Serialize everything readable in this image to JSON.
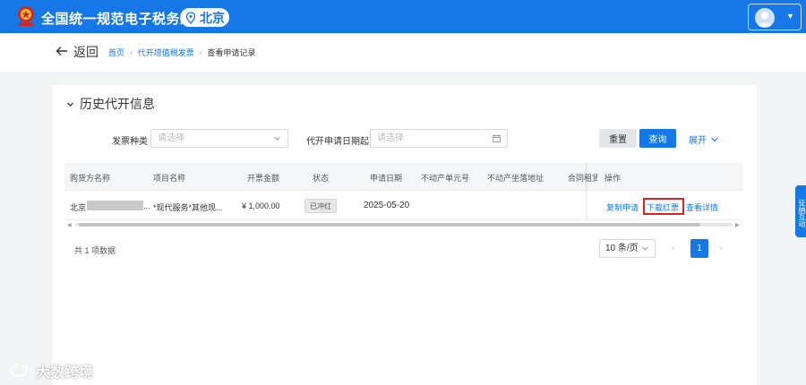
{
  "header": {
    "site_title": "全国统一规范电子税务局",
    "region": "北京"
  },
  "subheader": {
    "back_label": "返回",
    "breadcrumb": [
      "首页",
      "代开增值税发票",
      "查看申请记录"
    ]
  },
  "section": {
    "title": "历史代开信息"
  },
  "filters": {
    "invoice_type_label": "发票种类",
    "invoice_type_placeholder": "请选择",
    "apply_date_label": "代开申请日期起",
    "apply_date_placeholder": "请选择",
    "reset_label": "重置",
    "query_label": "查询",
    "expand_label": "展开"
  },
  "table": {
    "columns": [
      "购货方名称",
      "项目名称",
      "开票金额",
      "状态",
      "申请日期",
      "不动产单元号",
      "不动产坐落地址",
      "合同租赁",
      "操作"
    ],
    "rows": [
      {
        "buyer": "北京",
        "buyer_suffix": "...",
        "item": "*现代服务*其他现...",
        "amount": "¥ 1,000.00",
        "status": "已冲红",
        "date": "2025-05-20",
        "unit_no": "",
        "address": "",
        "actions": [
          "复制申请",
          "下载红票",
          "查看详情"
        ]
      }
    ]
  },
  "pagination": {
    "total_text": "共 1 项数据",
    "page_size": "10 条/页",
    "current_page": "1"
  },
  "side_tab": {
    "label": "征纳互动"
  },
  "watermark": {
    "text": "大数跨境"
  },
  "colors": {
    "primary": "#1677e6",
    "highlight": "#e02020"
  }
}
